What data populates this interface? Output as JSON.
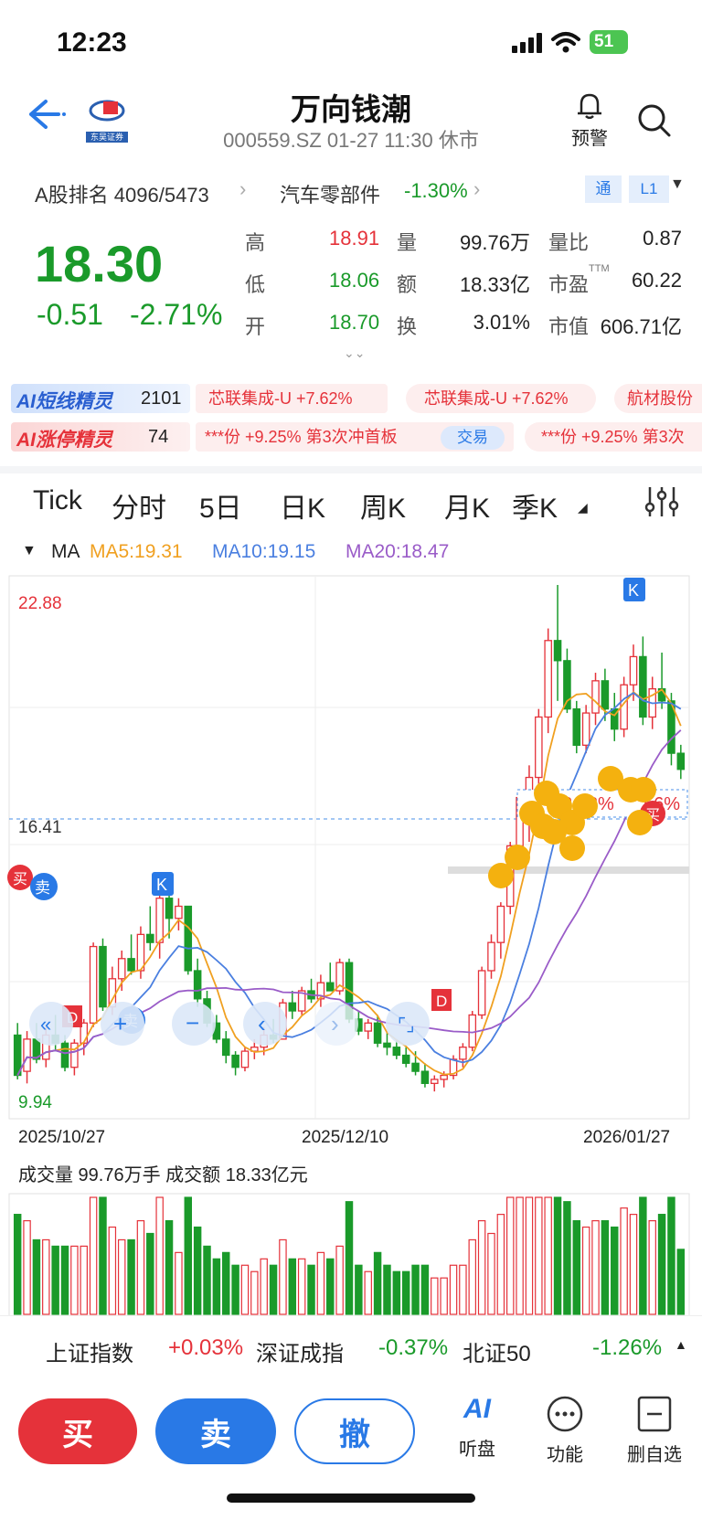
{
  "status_bar": {
    "time": "12:23",
    "battery": "51"
  },
  "header": {
    "stock_name": "万向钱潮",
    "subtitle": "000559.SZ 01-27 11:30 休市",
    "alert_label": "预警",
    "logo_text": "东吴证券"
  },
  "rank_bar": {
    "rank_label": "A股排名 4096/5473",
    "sector_name": "汽车零部件",
    "sector_change": "-1.30%",
    "tag_tong": "通",
    "tag_level": "L1"
  },
  "quote": {
    "price": "18.30",
    "change": "-0.51",
    "change_pct": "-2.71%",
    "high_label": "高",
    "high": "18.91",
    "low_label": "低",
    "low": "18.06",
    "open_label": "开",
    "open": "18.70",
    "vol_label": "量",
    "vol": "99.76万",
    "amt_label": "额",
    "amt": "18.33亿",
    "turnover_label": "换",
    "turnover": "3.01%",
    "ratio_label": "量比",
    "ratio": "0.87",
    "pe_label": "市盈",
    "pe_sup": "TTM",
    "pe": "60.22",
    "mcap_label": "市值",
    "mcap": "606.71亿"
  },
  "ai_rows": {
    "row1_label": "AI短线精灵",
    "row1_count": "2101",
    "row1_items": [
      "芯联集成-U +7.62%",
      "芯联集成-U +7.62%",
      "航材股份"
    ],
    "row2_label": "AI涨停精灵",
    "row2_count": "74",
    "row2_item": "***份 +9.25% 第3次冲首板",
    "row2_btn": "交易",
    "row2_item2": "***份 +9.25% 第3次"
  },
  "tabs": [
    "Tick",
    "分时",
    "5日",
    "日K",
    "周K",
    "月K",
    "季K"
  ],
  "active_tab": "日K",
  "ma_legend": {
    "label": "MA",
    "ma5": "MA5:19.31",
    "ma10": "MA10:19.15",
    "ma20": "MA20:18.47"
  },
  "chart_labels": {
    "top_price": "22.88",
    "bottom_price": "9.94",
    "ref_price": "16.41",
    "hover_box": "72.78%",
    "hover_box2": "56%",
    "date_start": "2025/10/27",
    "date_mid": "2025/12/10",
    "date_end": "2026/01/27",
    "vol_label": "成交量 99.76万手  成交额 18.33亿元"
  },
  "chart_data": {
    "type": "candlestick",
    "ylim": [
      9.94,
      22.88
    ],
    "candles": [
      [
        11.7,
        12.0,
        10.6,
        10.7
      ],
      [
        10.8,
        11.8,
        10.5,
        11.6
      ],
      [
        11.6,
        12.0,
        11.0,
        11.1
      ],
      [
        11.1,
        11.9,
        10.9,
        11.7
      ],
      [
        11.7,
        12.2,
        11.3,
        11.5
      ],
      [
        11.5,
        11.7,
        10.8,
        10.9
      ],
      [
        10.9,
        11.6,
        10.7,
        11.5
      ],
      [
        11.5,
        12.1,
        11.2,
        12.0
      ],
      [
        12.0,
        14.0,
        11.9,
        13.9
      ],
      [
        13.9,
        14.1,
        12.3,
        12.4
      ],
      [
        12.4,
        13.4,
        12.2,
        13.1
      ],
      [
        13.1,
        13.8,
        12.8,
        13.6
      ],
      [
        13.6,
        14.2,
        13.2,
        13.3
      ],
      [
        13.3,
        14.4,
        13.1,
        14.2
      ],
      [
        14.2,
        14.9,
        13.8,
        14.0
      ],
      [
        14.0,
        15.3,
        13.6,
        15.1
      ],
      [
        15.1,
        15.4,
        14.1,
        14.6
      ],
      [
        14.6,
        15.1,
        14.3,
        14.9
      ],
      [
        14.9,
        14.9,
        13.2,
        13.3
      ],
      [
        13.3,
        13.6,
        12.4,
        12.6
      ],
      [
        12.6,
        12.8,
        11.9,
        12.0
      ],
      [
        12.0,
        12.2,
        11.5,
        11.6
      ],
      [
        11.6,
        11.8,
        11.0,
        11.2
      ],
      [
        11.2,
        11.3,
        10.7,
        10.9
      ],
      [
        10.9,
        11.4,
        10.8,
        11.3
      ],
      [
        11.3,
        11.6,
        11.1,
        11.4
      ],
      [
        11.4,
        11.9,
        11.2,
        11.7
      ],
      [
        11.7,
        12.1,
        11.5,
        11.6
      ],
      [
        11.6,
        12.6,
        11.6,
        12.5
      ],
      [
        12.5,
        12.8,
        12.1,
        12.3
      ],
      [
        12.3,
        12.9,
        12.2,
        12.8
      ],
      [
        12.8,
        13.1,
        12.5,
        12.6
      ],
      [
        12.6,
        13.2,
        12.4,
        13.0
      ],
      [
        13.0,
        13.5,
        12.8,
        12.8
      ],
      [
        12.8,
        13.6,
        12.7,
        13.5
      ],
      [
        13.5,
        13.6,
        12.0,
        12.1
      ],
      [
        12.1,
        12.3,
        11.7,
        11.8
      ],
      [
        11.8,
        12.1,
        11.6,
        12.0
      ],
      [
        12.0,
        12.2,
        11.4,
        11.5
      ],
      [
        11.5,
        11.8,
        11.2,
        11.4
      ],
      [
        11.4,
        11.6,
        11.1,
        11.2
      ],
      [
        11.2,
        11.4,
        10.9,
        11.0
      ],
      [
        11.0,
        11.3,
        10.7,
        10.8
      ],
      [
        10.8,
        11.0,
        10.4,
        10.5
      ],
      [
        10.5,
        10.7,
        10.3,
        10.6
      ],
      [
        10.6,
        10.8,
        10.4,
        10.7
      ],
      [
        10.7,
        11.2,
        10.6,
        11.1
      ],
      [
        11.1,
        11.5,
        10.9,
        11.4
      ],
      [
        11.4,
        12.3,
        11.3,
        12.2
      ],
      [
        12.2,
        13.4,
        12.1,
        13.3
      ],
      [
        13.3,
        14.2,
        13.1,
        14.0
      ],
      [
        14.0,
        15.0,
        13.6,
        14.9
      ],
      [
        14.9,
        16.5,
        14.7,
        16.4
      ],
      [
        16.4,
        17.8,
        15.9,
        17.6
      ],
      [
        17.6,
        18.4,
        16.5,
        18.1
      ],
      [
        18.1,
        19.8,
        17.9,
        19.6
      ],
      [
        19.6,
        21.8,
        19.2,
        21.5
      ],
      [
        21.5,
        22.88,
        20.0,
        21.0
      ],
      [
        21.0,
        21.3,
        19.7,
        19.8
      ],
      [
        19.8,
        20.0,
        18.7,
        18.9
      ],
      [
        18.9,
        19.9,
        18.7,
        19.7
      ],
      [
        19.7,
        20.7,
        19.4,
        20.5
      ],
      [
        20.5,
        20.8,
        19.5,
        19.8
      ],
      [
        19.8,
        20.2,
        19.0,
        19.3
      ],
      [
        19.3,
        20.6,
        19.1,
        20.4
      ],
      [
        20.4,
        21.4,
        20.0,
        21.1
      ],
      [
        21.1,
        21.6,
        19.4,
        19.6
      ],
      [
        19.6,
        20.6,
        19.3,
        20.3
      ],
      [
        20.3,
        21.2,
        19.8,
        20.0
      ],
      [
        20.0,
        20.2,
        18.4,
        18.7
      ],
      [
        18.7,
        18.91,
        18.06,
        18.3
      ]
    ],
    "ma5_last": 19.31,
    "ma10_last": 19.15,
    "ma20_last": 18.47,
    "volume_unit": "万手",
    "volume_last": 99.76
  },
  "index_bar": [
    {
      "name": "上证指数",
      "change": "+0.03%"
    },
    {
      "name": "深证成指",
      "change": "-0.37%"
    },
    {
      "name": "北证50",
      "change": "-1.26%"
    }
  ],
  "actions": {
    "buy": "买",
    "sell": "卖",
    "cancel": "撤"
  },
  "tools": [
    {
      "label": "听盘",
      "icon": "ai-listen-icon"
    },
    {
      "label": "功能",
      "icon": "more-dots-icon"
    },
    {
      "label": "删自选",
      "icon": "remove-watchlist-icon"
    }
  ],
  "colors": {
    "up": "#e5323a",
    "down": "#1a9a2a",
    "accent": "#2979e6",
    "ma5": "#f0a020",
    "ma10": "#4a7fe0",
    "ma20": "#9a5cc8"
  }
}
